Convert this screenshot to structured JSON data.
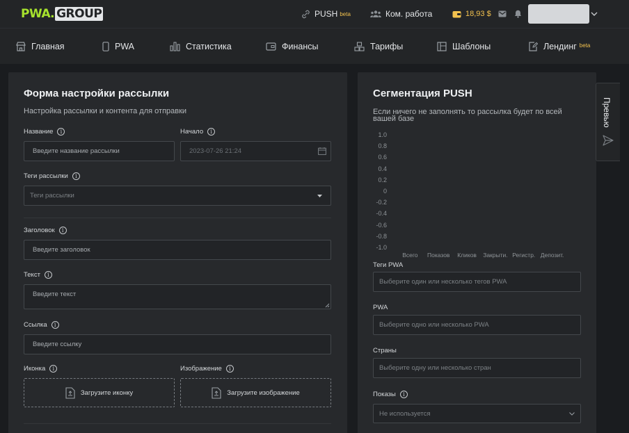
{
  "header": {
    "logo_part1": "PWA",
    "logo_dot": ".",
    "logo_part2": "GROUP",
    "push_label": "PUSH",
    "push_badge": "beta",
    "team_label": "Ком. работа",
    "balance": "18,93 $"
  },
  "nav": {
    "items": [
      {
        "label": "Главная",
        "icon": "store-icon"
      },
      {
        "label": "PWA",
        "icon": "phone-icon"
      },
      {
        "label": "Статистика",
        "icon": "bar-chart-icon"
      },
      {
        "label": "Финансы",
        "icon": "wallet-icon"
      },
      {
        "label": "Тарифы",
        "icon": "boxes-icon"
      },
      {
        "label": "Шаблоны",
        "icon": "layout-icon"
      },
      {
        "label": "Лендинг",
        "icon": "edit-page-icon",
        "badge": "beta"
      }
    ]
  },
  "form": {
    "title": "Форма настройки рассылки",
    "subtitle": "Настройка рассылки и контента для отправки",
    "name_label": "Название",
    "name_placeholder": "Введите название рассылки",
    "start_label": "Начало",
    "start_value": "2023-07-26 21:24",
    "tags_label": "Теги рассылки",
    "tags_placeholder": "Теги рассылки",
    "heading_label": "Заголовок",
    "heading_placeholder": "Введите заголовок",
    "text_label": "Текст",
    "text_placeholder": "Введите текст",
    "link_label": "Ссылка",
    "link_placeholder": "Введите ссылку",
    "icon_label": "Иконка",
    "icon_upload": "Загрузите иконку",
    "image_label": "Изображение",
    "image_upload": "Загрузите изображение"
  },
  "segmentation": {
    "title": "Сегментация PUSH",
    "subtitle_line1": "Если ничего не заполнять то рассылка будет по всей",
    "subtitle_line2": "вашей базе",
    "pwa_tags_label": "Теги PWA",
    "pwa_tags_placeholder": "Выберите один или несколько тегов PWA",
    "pwa_label": "PWA",
    "pwa_placeholder": "Выберите одно или несколько PWA",
    "countries_label": "Страны",
    "countries_placeholder": "Выберите одну или несколько стран",
    "shows_label": "Показы",
    "shows_value": "Не используется"
  },
  "preview": {
    "label": "Превью"
  },
  "chart_data": {
    "type": "bar",
    "categories": [
      "Всего",
      "Показов",
      "Кликов",
      "Закрыти.",
      "Регистр.",
      "Депозит."
    ],
    "values": [
      0,
      0,
      0,
      0,
      0,
      0
    ],
    "yticks": [
      "1.0",
      "0.8",
      "0.6",
      "0.4",
      "0.2",
      "0",
      "-0.2",
      "-0.4",
      "-0.6",
      "-0.8",
      "-1.0"
    ],
    "ylim": [
      -1.0,
      1.0
    ],
    "grid": false
  }
}
